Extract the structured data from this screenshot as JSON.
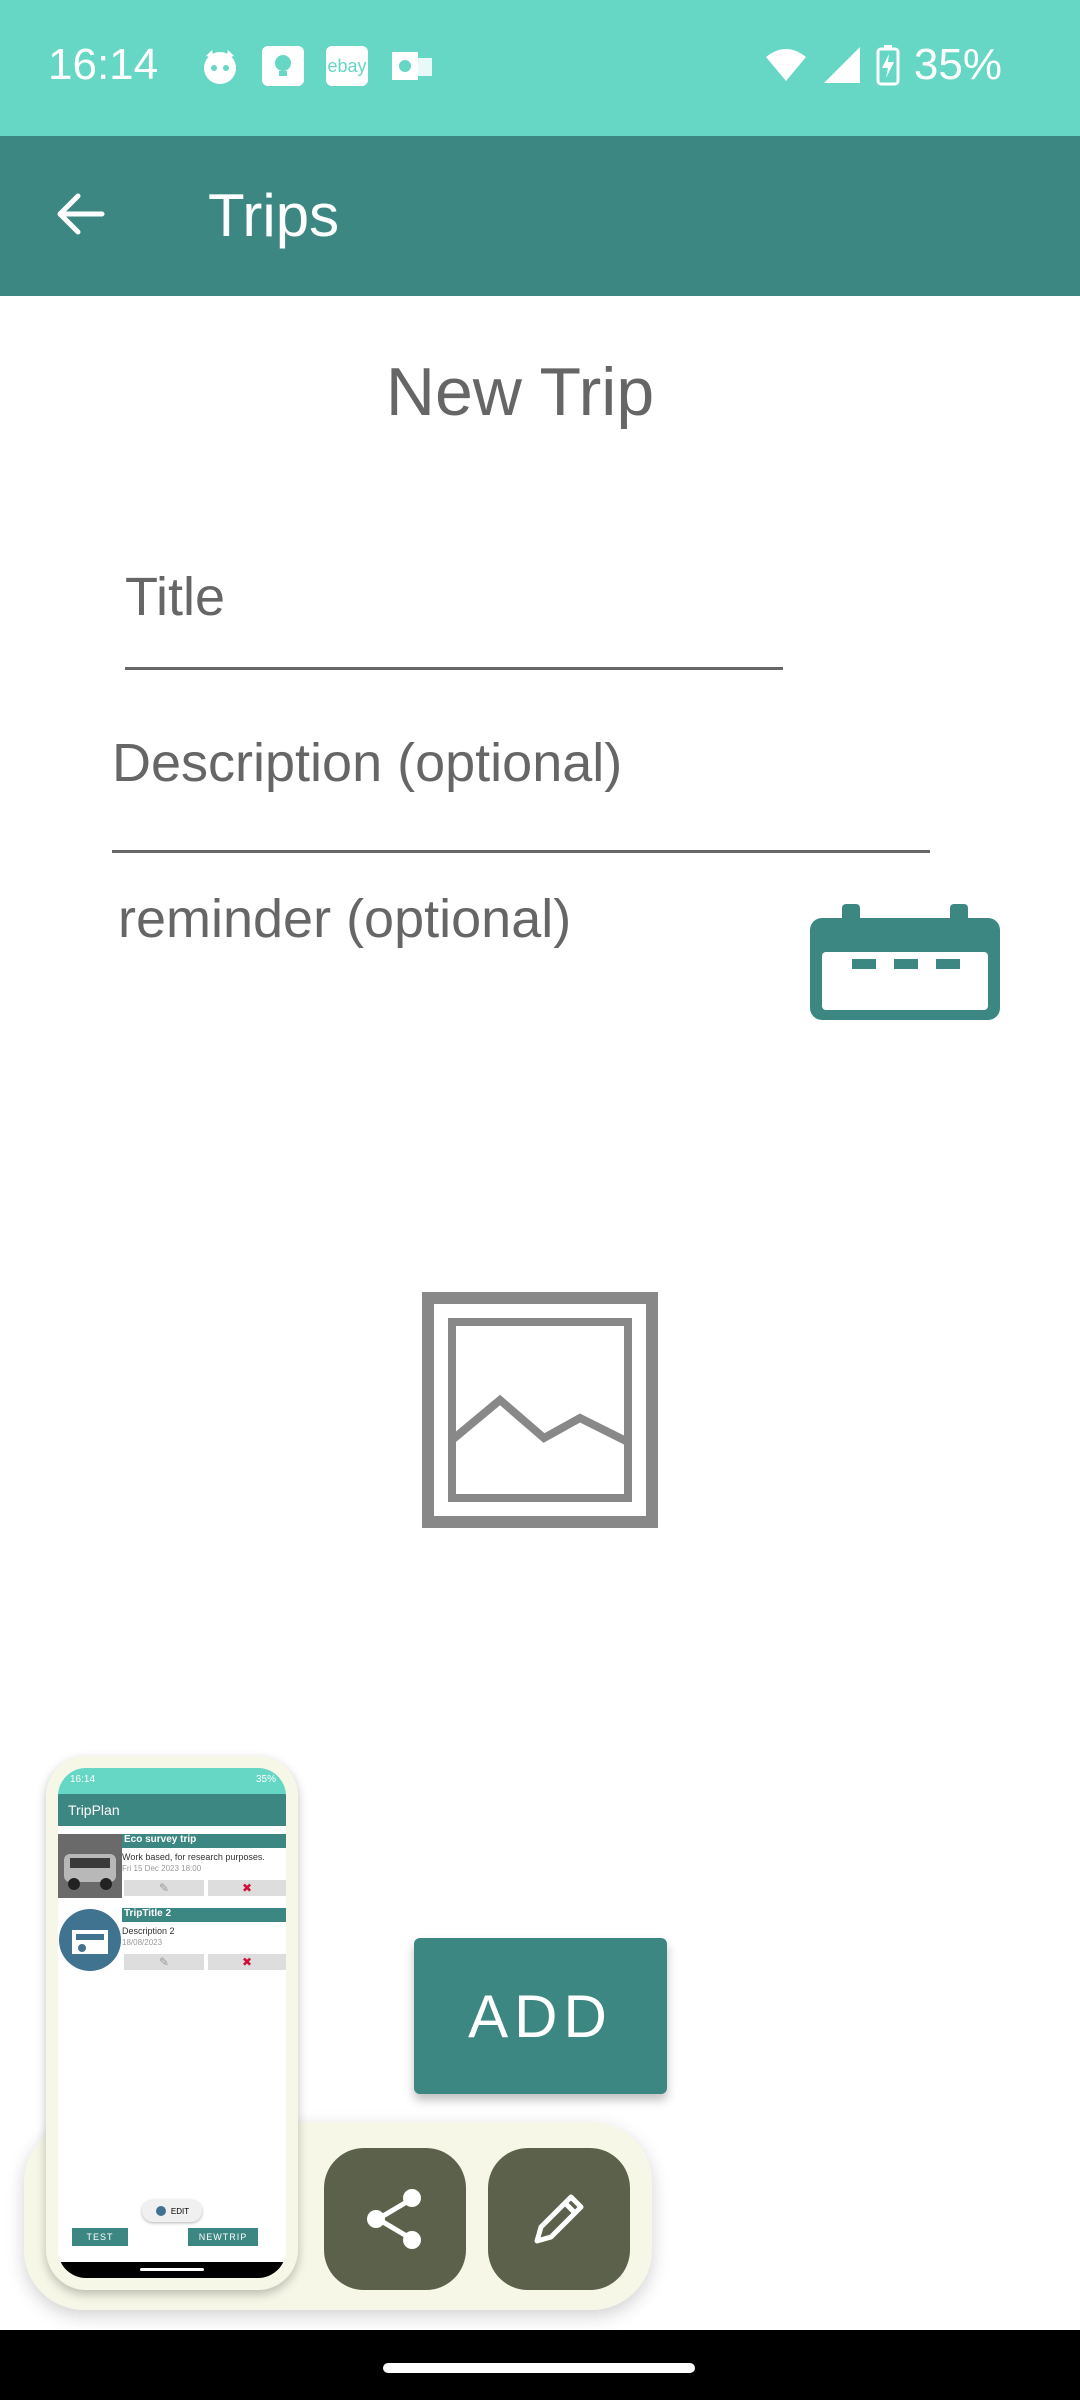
{
  "status": {
    "time": "16:14",
    "battery": "35%",
    "notification_icons": [
      "cat-icon",
      "lightbulb-icon",
      "ebay-icon",
      "outlook-icon"
    ],
    "ebay_label": "ebay"
  },
  "appbar": {
    "title": "Trips",
    "back_icon": "arrow-left-icon"
  },
  "form": {
    "heading": "New Trip",
    "title_placeholder": "Title",
    "description_placeholder": "Description (optional)",
    "reminder_label": "reminder (optional)",
    "add_label": "ADD"
  },
  "colors": {
    "status_bar": "#66d6c5",
    "primary": "#3d8782",
    "fab": "#5b614a",
    "panel": "#f7f7e8"
  },
  "thumbnail": {
    "status_time": "16:14",
    "status_battery": "35%",
    "app_title": "TripPlan",
    "trips": [
      {
        "title": "Eco survey trip",
        "description": "Work based, for research purposes.",
        "date": "Fri 15 Dec 2023 18:00"
      },
      {
        "title": "TripTitle 2",
        "description": "Description 2",
        "date": "18/08/2023"
      }
    ],
    "edit_label": "EDIT",
    "test_label": "TEST",
    "newtrip_label": "NEWTRIP"
  }
}
